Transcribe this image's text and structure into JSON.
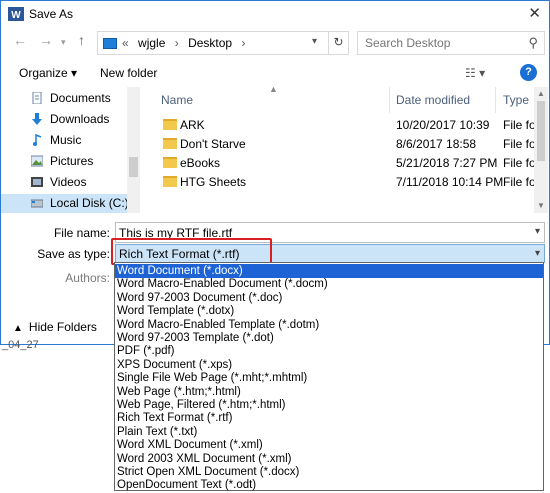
{
  "app": {
    "icon": "word-icon",
    "icon_glyph": "W",
    "title": "Save As"
  },
  "address": {
    "crumbs": [
      "«",
      "wjgle",
      "›",
      "Desktop",
      "›"
    ],
    "search_placeholder": "Search Desktop"
  },
  "toolbar": {
    "organize": "Organize ▾",
    "new_folder": "New folder",
    "help": "?"
  },
  "nav_items": [
    {
      "label": "Documents",
      "icon": "documents-icon"
    },
    {
      "label": "Downloads",
      "icon": "downloads-icon"
    },
    {
      "label": "Music",
      "icon": "music-icon"
    },
    {
      "label": "Pictures",
      "icon": "pictures-icon"
    },
    {
      "label": "Videos",
      "icon": "videos-icon"
    },
    {
      "label": "Local Disk (C:)",
      "icon": "local-disk-icon",
      "selected": true
    }
  ],
  "columns": {
    "name": "Name",
    "date": "Date modified",
    "type": "Type"
  },
  "files": [
    {
      "name": "ARK",
      "date": "10/20/2017 10:39",
      "type": "File fo"
    },
    {
      "name": "Don't Starve",
      "date": "8/6/2017 18:58",
      "type": "File fo"
    },
    {
      "name": "eBooks",
      "date": "5/21/2018 7:27 PM",
      "type": "File fo"
    },
    {
      "name": "HTG Sheets",
      "date": "7/11/2018 10:14 PM",
      "type": "File fo"
    }
  ],
  "form": {
    "file_name_label": "File name:",
    "file_name_value": "This is my RTF file.rtf",
    "save_as_type_label": "Save as type:",
    "save_as_type_value": "Rich Text Format (*.rtf)",
    "authors_label": "Authors:"
  },
  "hide_folders": "Hide Folders",
  "background_text": "_04_27",
  "file_types": [
    "Word Document (*.docx)",
    "Word Macro-Enabled Document (*.docm)",
    "Word 97-2003 Document (*.doc)",
    "Word Template (*.dotx)",
    "Word Macro-Enabled Template (*.dotm)",
    "Word 97-2003 Template (*.dot)",
    "PDF (*.pdf)",
    "XPS Document (*.xps)",
    "Single File Web Page (*.mht;*.mhtml)",
    "Web Page (*.htm;*.html)",
    "Web Page, Filtered (*.htm;*.html)",
    "Rich Text Format (*.rtf)",
    "Plain Text (*.txt)",
    "Word XML Document (*.xml)",
    "Word 2003 XML Document (*.xml)",
    "Strict Open XML Document (*.docx)",
    "OpenDocument Text (*.odt)"
  ],
  "highlighted_index": 0,
  "colors": {
    "accent": "#1e63d6",
    "highlight_box": "#d92020",
    "selection": "#cce4f7"
  }
}
